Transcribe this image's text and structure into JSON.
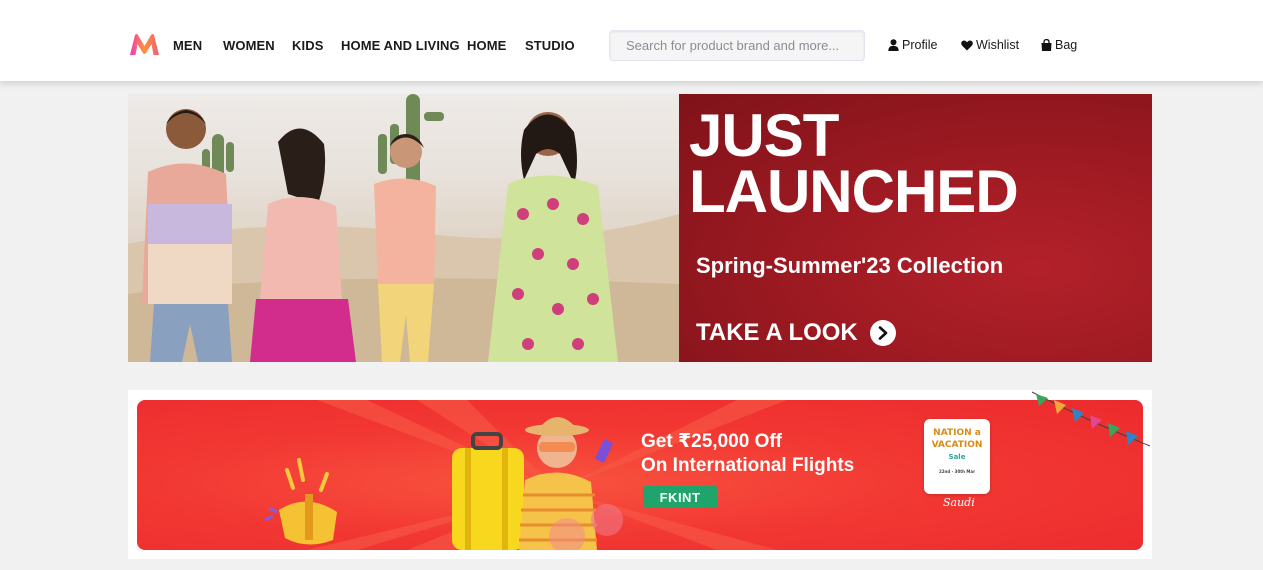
{
  "header": {
    "logo_name": "myntra-logo",
    "nav": [
      {
        "label": "MEN"
      },
      {
        "label": "WOMEN"
      },
      {
        "label": "KIDS"
      },
      {
        "label": "HOME AND LIVING"
      },
      {
        "label": "HOME"
      },
      {
        "label": "STUDIO"
      }
    ],
    "search": {
      "placeholder": "Search for product brand and more..."
    },
    "actions": {
      "profile": "Profile",
      "wishlist": "Wishlist",
      "bag": "Bag"
    }
  },
  "hero": {
    "headline_line1": "JUST",
    "headline_line2": "LAUNCHED",
    "subtitle": "Spring-Summer'23 Collection",
    "cta": "TAKE A LOOK",
    "accent_color": "#9e1a22"
  },
  "promo": {
    "title_line1": "Get ₹25,000 Off",
    "title_line2": "On International Flights",
    "coupon_code": "FKINT",
    "badge_line1": "NATION a",
    "badge_line2": "VACATION",
    "badge_line3": "Sale",
    "badge_line4": "22nd - 30th Mar",
    "sponsor": "Saudi",
    "accent_color": "#f23833"
  }
}
